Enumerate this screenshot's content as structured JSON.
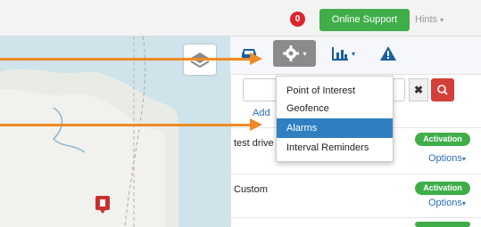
{
  "topbar": {
    "notification_count": "0",
    "support_label": "Online Support",
    "hints_label": "Hints"
  },
  "toolbar": {
    "icons": [
      "car-icon",
      "gear-icon",
      "chart-icon",
      "warning-icon"
    ]
  },
  "dropdown": {
    "items": [
      "Point of Interest",
      "Geofence",
      "Alarms",
      "Interval Reminders"
    ],
    "active_index": 2
  },
  "search": {
    "placeholder": ""
  },
  "add_link": "Add",
  "list": [
    {
      "name": "test drive",
      "badge": "Activation",
      "options": "Options"
    },
    {
      "name": "Custom",
      "badge": "Activation",
      "options": "Options"
    }
  ],
  "colors": {
    "accent_green": "#3fae49",
    "alert_red": "#d9262e",
    "highlight_blue": "#2f7fc1",
    "arrow_orange": "#f08a24"
  }
}
